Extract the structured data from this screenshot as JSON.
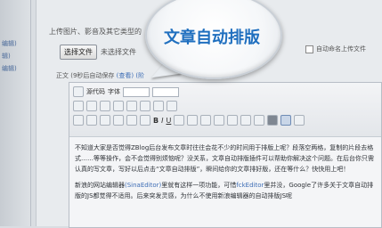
{
  "sidebar": {
    "links": [
      "编辑)",
      "辑)",
      "编辑)"
    ]
  },
  "upload": {
    "hint": "上传图片、影音及其它类型的",
    "choose_button": "选择文件",
    "file_status": "未选择文件",
    "auto_name_label": "自动命名上传文件"
  },
  "body_field": {
    "label": "正文",
    "autosave": "(9秒后自动保存",
    "view_link": "(查看)",
    "extra": "(阶"
  },
  "toolbar": {
    "source_label": "源代码",
    "font_label": "字体",
    "bold": "B",
    "italic": "I",
    "underline": "U"
  },
  "editor_content": {
    "paragraph1": "不知道大家是否觉得ZBlog后台发布文章时往往会花不少的时间用于排版上呢？段落空两格，复制的片段去格式……等等操作，会不会觉得别烦恼呢？没关系，文章自动排版插件可以帮助你解决这个问题。在后台你只需认真的写文章，写好以后点击“文章自动排版”，瞬间给你的文章排好版，还在等什么？快快用上吧！",
    "paragraph2_start": "新浪的网站编辑器",
    "paragraph2_link1": "(SinaEditor)",
    "paragraph2_mid": "里就有这样一项功能，可惜",
    "paragraph2_link2": "fckEditor",
    "paragraph2_end": "里并没，Google了许多关于文章自动排版的JS都觉得不适用。后来突发灵感，为什么不使用新浪编辑器的自动排版JS呢"
  },
  "callout": {
    "title": "文章自动排版"
  }
}
